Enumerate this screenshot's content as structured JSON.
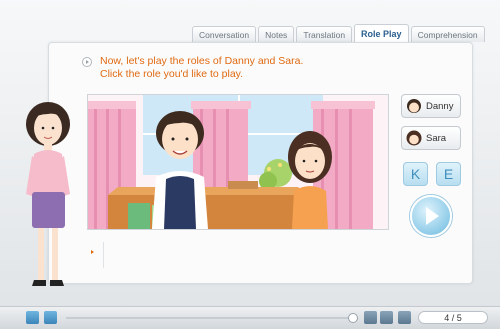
{
  "tabs": [
    {
      "label": "Conversation",
      "active": false
    },
    {
      "label": "Notes",
      "active": false
    },
    {
      "label": "Translation",
      "active": false
    },
    {
      "label": "Role Play",
      "active": true
    },
    {
      "label": "Comprehension",
      "active": false
    }
  ],
  "instruction": {
    "line1": "Now, let's play the roles of Danny and Sara.",
    "line2": "Click the role you'd like to play."
  },
  "roles": [
    {
      "label": "Danny"
    },
    {
      "label": "Sara"
    }
  ],
  "language_buttons": {
    "korean": "K",
    "english": "E"
  },
  "player": {
    "page": "4 / 5"
  },
  "colors": {
    "instruction_text": "#e06a12",
    "active_tab_text": "#2a5f8f",
    "accent_blue": "#3b84b8"
  }
}
